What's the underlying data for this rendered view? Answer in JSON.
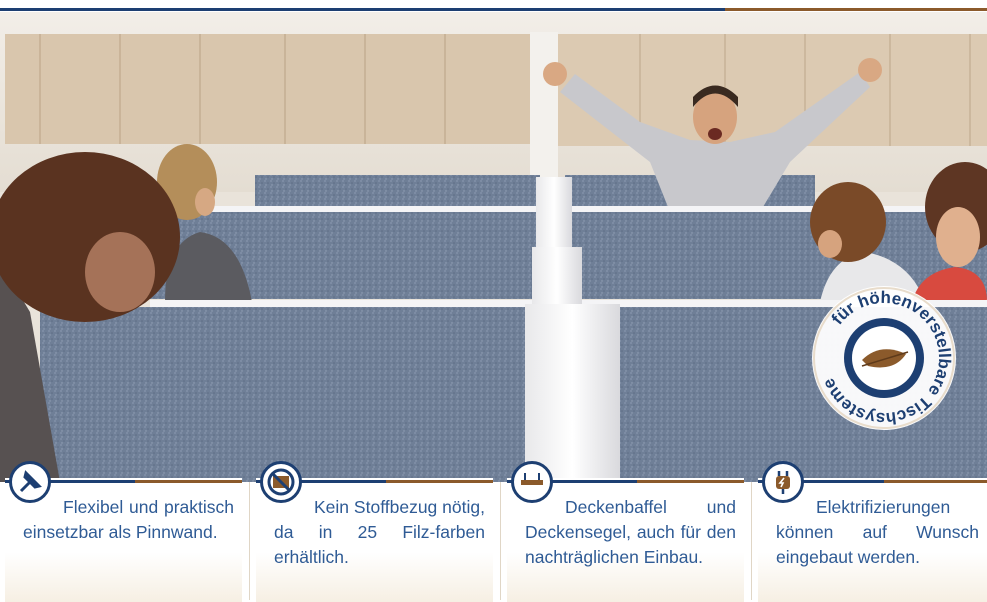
{
  "header": {
    "accent_primary": "#1d3f72",
    "accent_secondary": "#8b5a2b"
  },
  "seal": {
    "text": "für höhenverstellbare Tischsysteme",
    "icon": "feather-icon"
  },
  "features": [
    {
      "icon": "pushpin-icon",
      "text": "Flexibel und praktisch einsetzbar als Pinnwand."
    },
    {
      "icon": "no-fabric-icon",
      "text": "Kein Stoffbezug nötig, da in 25 Filz-farben erhältlich."
    },
    {
      "icon": "ceiling-baffle-icon",
      "text": "Deckenbaffel und Deckensegel, auch für den nachträglichen Einbau."
    },
    {
      "icon": "plug-icon",
      "text": "Elektrifizierungen können auf Wunsch eingebaut werden."
    }
  ]
}
